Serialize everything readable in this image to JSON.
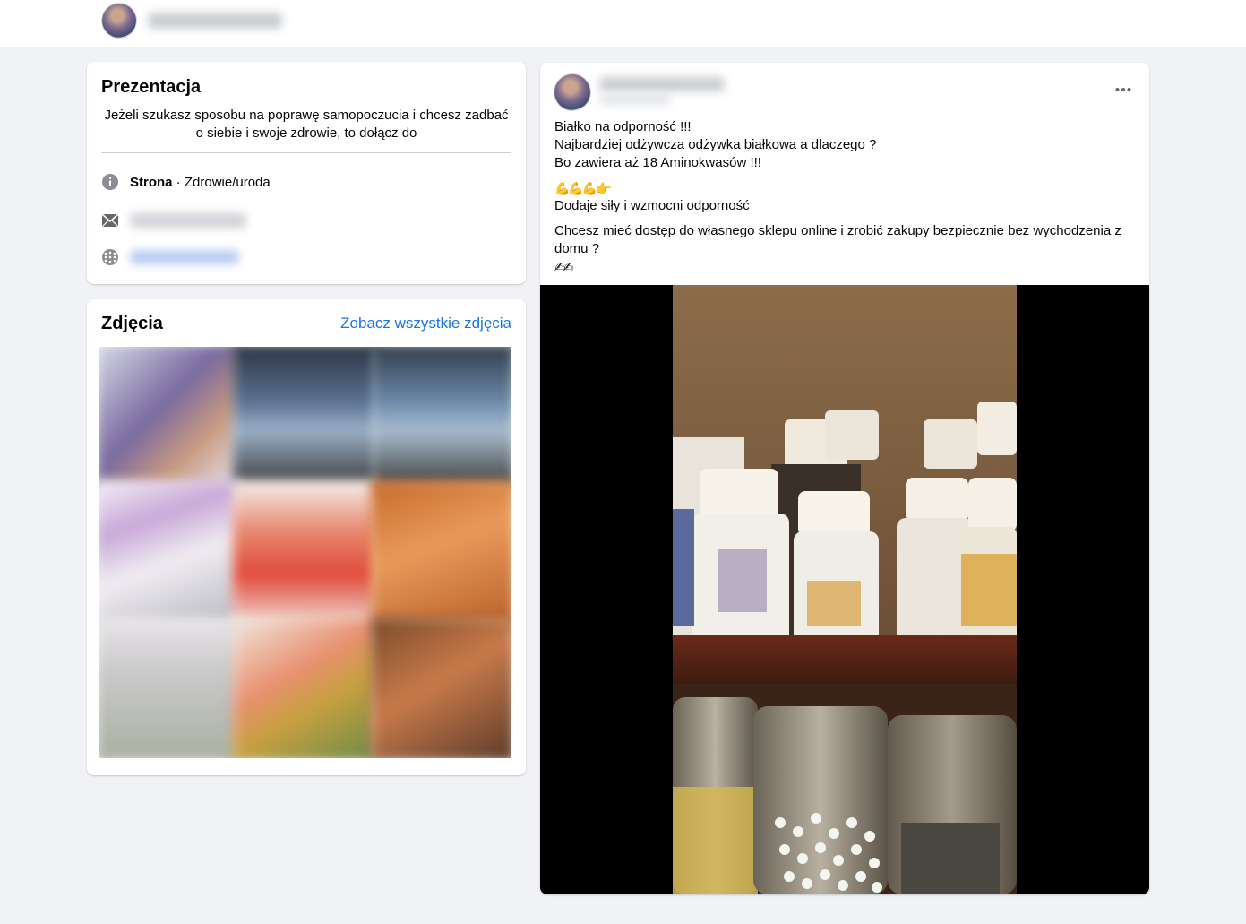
{
  "topbar": {
    "profile_name_hidden": ""
  },
  "intro": {
    "title": "Prezentacja",
    "bio": "Jeżeli szukasz sposobu na poprawę samopoczucia i chcesz zadbać o siebie i swoje zdrowie, to dołącz do",
    "category_label": "Strona",
    "category_value": " · Zdrowie/uroda",
    "icons": {
      "info": "info-icon",
      "email": "envelope-icon",
      "website": "globe-icon"
    }
  },
  "photos": {
    "title": "Zdjęcia",
    "see_all": "Zobacz wszystkie zdjęcia"
  },
  "post": {
    "lines": [
      "Białko na odporność !!!",
      "Najbardziej odżywcza odżywka białkowa a dlaczego ?",
      "Bo zawiera aż 18 Aminokwasów !!!"
    ],
    "emoji_row_1": "💪💪💪👉",
    "line_after_emoji": "Dodaje siły i wzmocni odporność",
    "paragraph": "Chcesz mieć dostęp do własnego sklepu online i zrobić zakupy bezpiecznie bez wychodzenia z domu ?",
    "emoji_row_2": "✍✍",
    "more_icon": "more-options-icon"
  },
  "colors": {
    "link": "#1b74e4",
    "background": "#f0f2f5",
    "card": "#ffffff"
  }
}
